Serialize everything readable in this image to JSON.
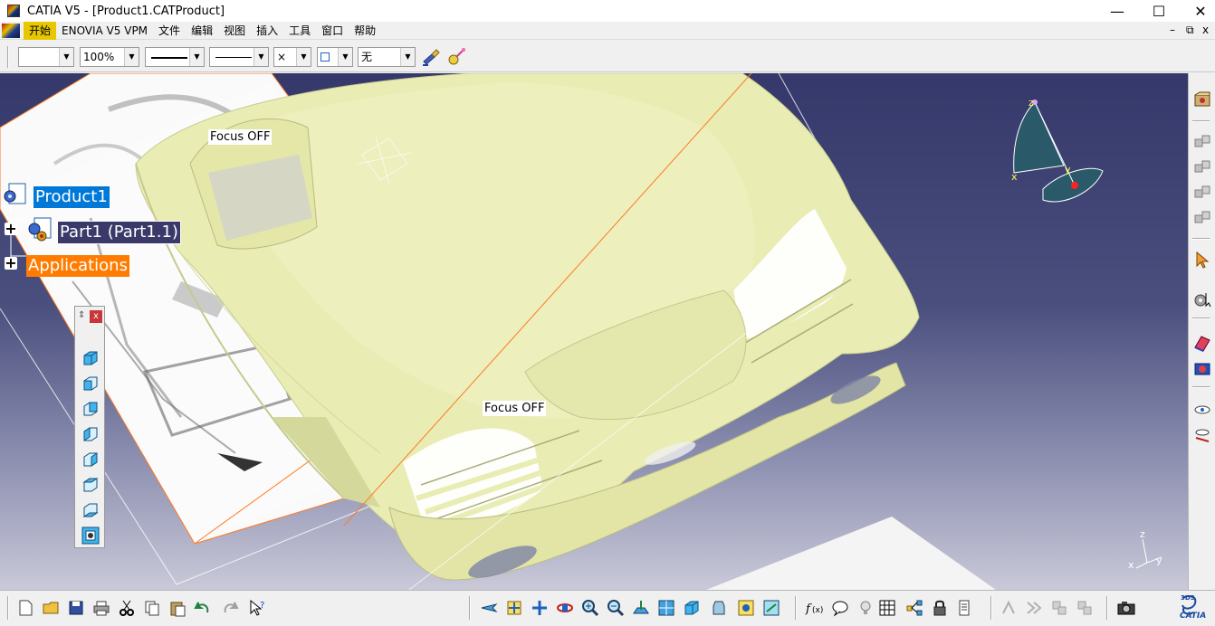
{
  "window": {
    "title": "CATIA V5 - [Product1.CATProduct]",
    "minimize_glyph": "—",
    "maximize_glyph": "☐",
    "close_glyph": "✕"
  },
  "menu": {
    "items": [
      "开始",
      "ENOVIA V5 VPM",
      "文件",
      "编辑",
      "视图",
      "插入",
      "工具",
      "窗口",
      "帮助"
    ],
    "mdi_minimize": "–",
    "mdi_restore": "⧉",
    "mdi_close": "x"
  },
  "properties_toolbar": {
    "color_value": "",
    "transparency_value": "100%",
    "point_value": "×",
    "layer_value": "无"
  },
  "tree": {
    "root": "Product1",
    "child": "Part1 (Part1.1)",
    "applications": "Applications"
  },
  "viewport": {
    "focus_label_1": "Focus OFF",
    "focus_label_2": "Focus OFF",
    "compass_x": "x",
    "compass_y": "y",
    "compass_z": "z",
    "axis_x": "x",
    "axis_y": "y",
    "axis_z": "z"
  },
  "view_panel": {
    "close_label": "x",
    "buttons": [
      "isometric-view",
      "front-view",
      "back-view",
      "left-view",
      "right-view",
      "top-view",
      "bottom-view",
      "named-views"
    ]
  },
  "colors": {
    "menu_active": "#e7c700",
    "tree_selected": "#0078d7",
    "tree_child_bg": "#3a3a6a",
    "applications_bg": "#ff7c00",
    "model_surface": "#e9ecb3",
    "background_top": "#35386a"
  },
  "bottom_toolbar": {
    "logo_text": "CATIA",
    "logo_prefix": "3DS"
  }
}
